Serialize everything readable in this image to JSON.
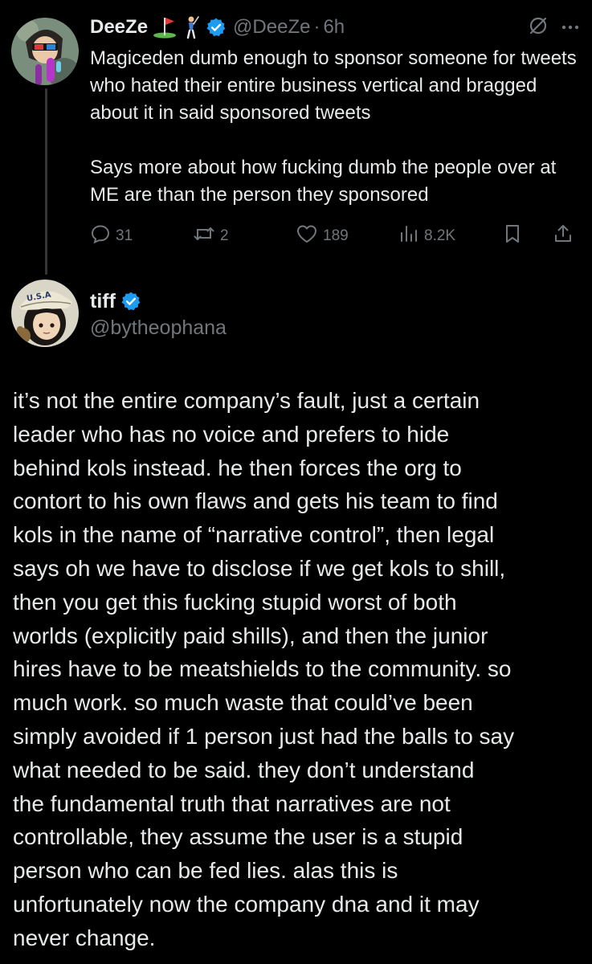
{
  "colors": {
    "background": "#000000",
    "text_primary": "#e7e9ea",
    "text_secondary": "#71767b",
    "verified_blue": "#1d9bf0",
    "thread_line": "#333639"
  },
  "reply_tweet": {
    "display_name": "DeeZe",
    "name_emojis": [
      "golf-flag-emoji",
      "golfer-emoji"
    ],
    "handle": "@DeeZe",
    "separator": "·",
    "time": "6h",
    "header_icons": [
      "grok-icon",
      "more-icon"
    ],
    "paragraphs": [
      "Magiceden dumb enough to sponsor someone for tweets who hated their entire business vertical and bragged about it in said sponsored tweets",
      "Says more about how fucking dumb the people over at ME are than the person they sponsored"
    ],
    "actions": {
      "reply_count": "31",
      "retweet_count": "2",
      "like_count": "189",
      "views_count": "8.2K"
    }
  },
  "main_tweet": {
    "display_name": "tiff",
    "handle": "@bytheophana",
    "avatar_cap_text": "U.S.A",
    "text": "it’s not the entire company’s fault, just a certain\nleader who has no voice and prefers to hide\nbehind kols instead. he then forces the org to\ncontort to his own flaws and gets his team to find\nkols in the name of “narrative control”, then legal\nsays oh we have to disclose if we get kols to shill,\nthen you get this fucking stupid worst of both\nworlds (explicitly paid shills), and then the junior\nhires have to be meatshields to the community. so\nmuch work. so much waste that could’ve been\nsimply avoided if 1 person just had the balls to say\nwhat needed to be said. they don’t understand\nthe fundamental truth that narratives are not\ncontrollable, they assume the user is a stupid\nperson who can be fed lies. alas this is\nunfortunately now the company dna and it may\nnever change."
  }
}
